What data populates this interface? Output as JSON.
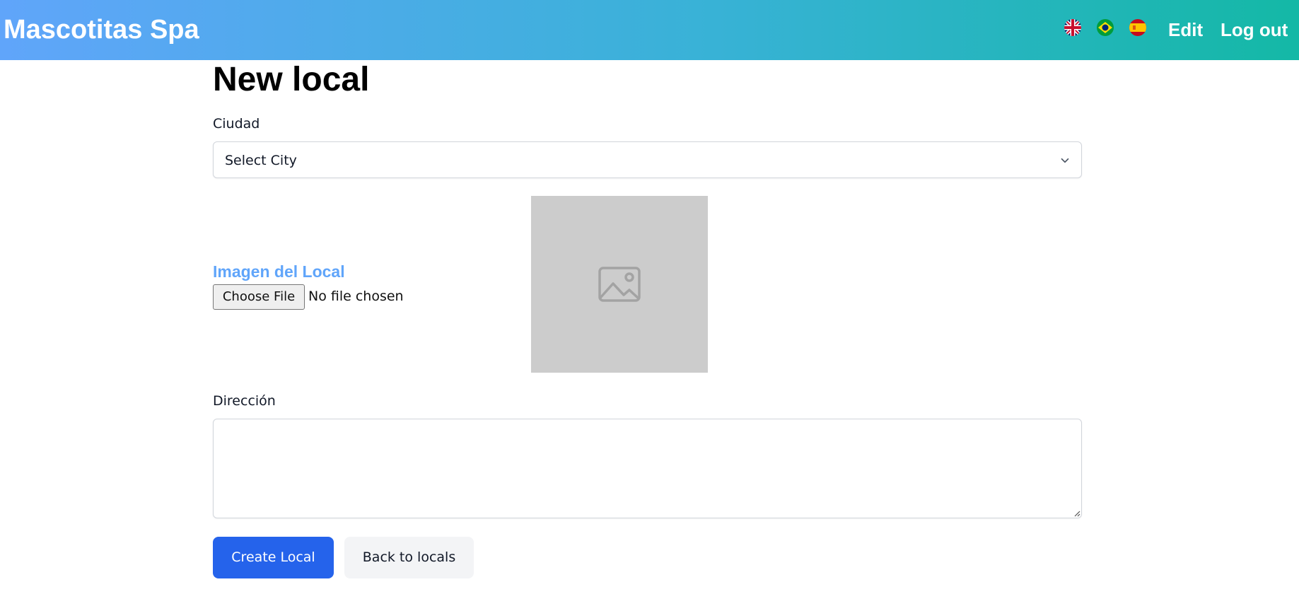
{
  "navbar": {
    "brand": "Mascotitas Spa",
    "flags": [
      {
        "icon": "uk-flag-icon",
        "lang": "en"
      },
      {
        "icon": "brazil-flag-icon",
        "lang": "pt"
      },
      {
        "icon": "spain-flag-icon",
        "lang": "es"
      }
    ],
    "edit_label": "Edit",
    "logout_label": "Log out"
  },
  "page": {
    "title": "New local"
  },
  "form": {
    "city_label": "Ciudad",
    "city_select": {
      "selected": "Select City"
    },
    "image_label": "Imagen del Local",
    "file_button_label": "Choose File",
    "file_status": "No file chosen",
    "image_preview_icon": "image-placeholder-icon",
    "address_label": "Dirección",
    "address_value": ""
  },
  "actions": {
    "create_label": "Create Local",
    "back_label": "Back to locals"
  },
  "colors": {
    "accent_primary": "#2563eb",
    "image_label": "#60a5fa",
    "navbar_gradient_start": "#60a5fa",
    "navbar_gradient_end": "#14b8a6"
  }
}
